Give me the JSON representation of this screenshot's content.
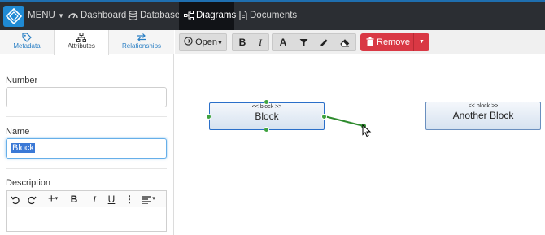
{
  "nav": {
    "menu_label": "MENU",
    "items": [
      {
        "label": "Dashboard",
        "icon": "dashboard-icon"
      },
      {
        "label": "Database",
        "icon": "database-icon"
      },
      {
        "label": "Diagrams",
        "icon": "diagram-icon",
        "active": true
      },
      {
        "label": "Documents",
        "icon": "document-icon"
      }
    ]
  },
  "sidebar": {
    "tabs": [
      {
        "label": "Metadata",
        "icon": "tag-icon"
      },
      {
        "label": "Attributes",
        "icon": "hierarchy-icon",
        "active": true
      },
      {
        "label": "Relationships",
        "icon": "swap-arrows-icon"
      }
    ],
    "fields": {
      "number": {
        "label": "Number",
        "value": ""
      },
      "name": {
        "label": "Name",
        "value": "Block"
      },
      "description": {
        "label": "Description",
        "value": ""
      }
    },
    "editor_toolbar": [
      "undo-icon",
      "redo-icon",
      "insert-icon",
      "bold-icon",
      "italic-icon",
      "underline-icon",
      "more-icon",
      "align-icon"
    ]
  },
  "toolbar": {
    "open_label": "Open",
    "remove_label": "Remove",
    "tools": [
      "bold-icon",
      "italic-icon",
      "text-icon",
      "filter-icon",
      "pencil-icon",
      "eraser-icon"
    ]
  },
  "canvas": {
    "blocks": [
      {
        "stereotype": "<< block >>",
        "name": "Block",
        "selected": true
      },
      {
        "stereotype": "<< block >>",
        "name": "Another Block",
        "selected": false
      }
    ]
  },
  "colors": {
    "nav_bg": "#2b2e33",
    "accent": "#1f8ad4",
    "remove": "#d93844",
    "connector": "#2e8b2e"
  }
}
